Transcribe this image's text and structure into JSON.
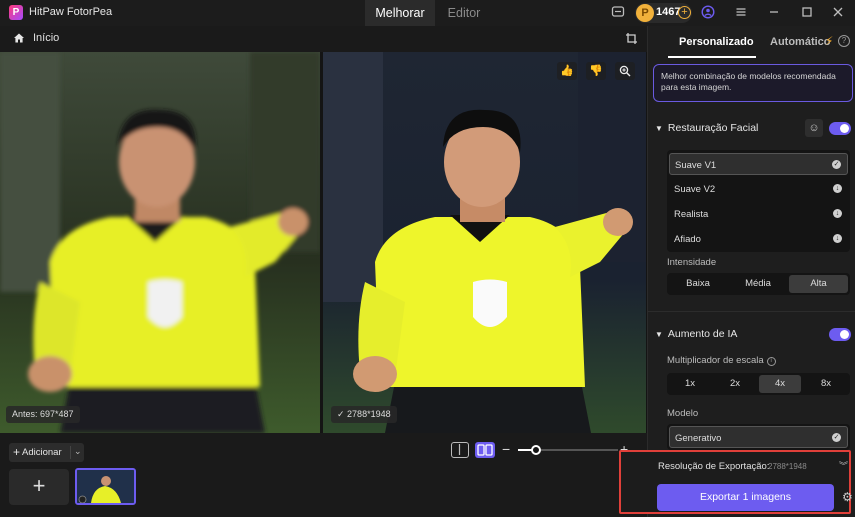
{
  "app": {
    "name": "HitPaw FotorPea"
  },
  "top_tabs": {
    "melhorar": "Melhorar",
    "editor": "Editor"
  },
  "coins": {
    "count": "1467"
  },
  "breadcrumb": {
    "home": "Início"
  },
  "before_badge": "Antes: 697*487",
  "after_badge": "2788*1948",
  "bottom": {
    "add_label": "Adicionar"
  },
  "sidebar": {
    "tab_custom": "Personalizado",
    "tab_auto": "Automático",
    "tip": "Melhor combinação de modelos recomendada para esta imagem.",
    "face": {
      "title": "Restauração Facial",
      "models": [
        "Suave V1",
        "Suave V2",
        "Realista",
        "Afiado"
      ],
      "intensity_label": "Intensidade",
      "intensity": [
        "Baixa",
        "Média",
        "Alta"
      ]
    },
    "upscale": {
      "title": "Aumento de IA",
      "scale_label": "Multiplicador de escala",
      "scales": [
        "1x",
        "2x",
        "4x",
        "8x"
      ],
      "model_label": "Modelo",
      "model_value": "Generativo"
    }
  },
  "export": {
    "label": "Resolução de Exportação:",
    "resolution": "2788*1948",
    "button": "Exportar 1 imagens"
  },
  "colors": {
    "accent": "#6d5cf0",
    "highlight_box": "#e0403a",
    "coin": "#f1b13b"
  }
}
